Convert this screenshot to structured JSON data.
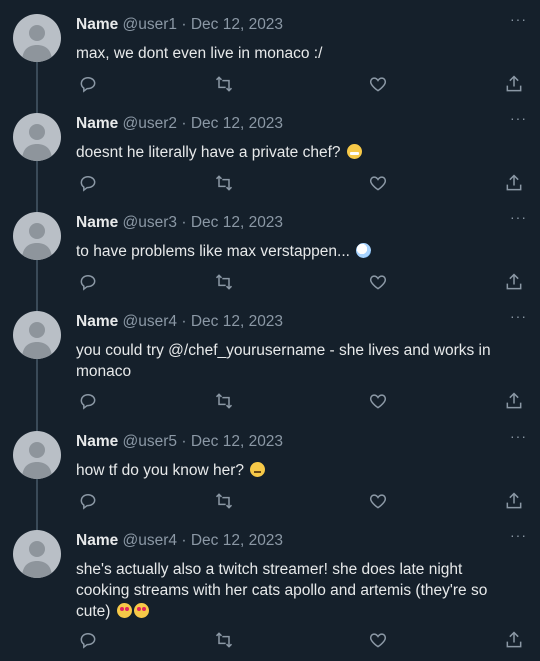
{
  "colors": {
    "background": "#15202b",
    "text": "#e7e9ea",
    "muted": "#8b98a5",
    "thread_line": "#3a4a58",
    "avatar": "#b9bfc6"
  },
  "more_label": "···",
  "icons": {
    "reply": "reply-icon",
    "retweet": "retweet-icon",
    "like": "heart-icon",
    "share": "share-icon",
    "more": "more-icon"
  },
  "tweets": [
    {
      "name": "Name",
      "handle": "@user1",
      "date": "Dec 12, 2023",
      "text": "max, we dont even live in monaco :/"
    },
    {
      "name": "Name",
      "handle": "@user2",
      "date": "Dec 12, 2023",
      "text": "doesnt he literally have a private chef?",
      "emoji": "grimacing-face"
    },
    {
      "name": "Name",
      "handle": "@user3",
      "date": "Dec 12, 2023",
      "text": "to have problems like max verstappen...",
      "emoji": "crystal-ball"
    },
    {
      "name": "Name",
      "handle": "@user4",
      "date": "Dec 12, 2023",
      "text": "you could try @/chef_yourusername - she lives and works in monaco"
    },
    {
      "name": "Name",
      "handle": "@user5",
      "date": "Dec 12, 2023",
      "text": "how tf do you know her?",
      "emoji": "confused-face"
    },
    {
      "name": "Name",
      "handle": "@user4",
      "date": "Dec 12, 2023",
      "text": "she's actually also a twitch streamer! she does late night cooking streams with her cats apollo and artemis (they're so cute)",
      "emoji": "heart-eyes-face"
    }
  ]
}
